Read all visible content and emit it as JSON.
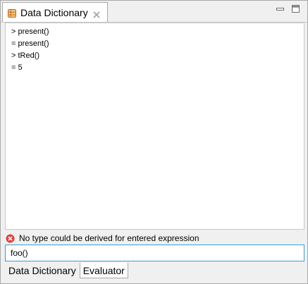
{
  "view": {
    "title": "Data Dictionary",
    "icon": "data-dictionary-grid-icon"
  },
  "console": {
    "lines": [
      "> present()",
      "= present()",
      "> tRed()",
      "= 5"
    ]
  },
  "error": {
    "icon": "error-icon",
    "message": "No type could be derived for entered expression"
  },
  "input": {
    "value": "foo()"
  },
  "bottom_tabs": [
    {
      "label": "Data Dictionary",
      "active": false
    },
    {
      "label": "Evaluator",
      "active": true
    }
  ],
  "colors": {
    "error_red": "#e0413a",
    "focus_border": "#3c9bd6",
    "icon_orange": "#d07a2c"
  }
}
